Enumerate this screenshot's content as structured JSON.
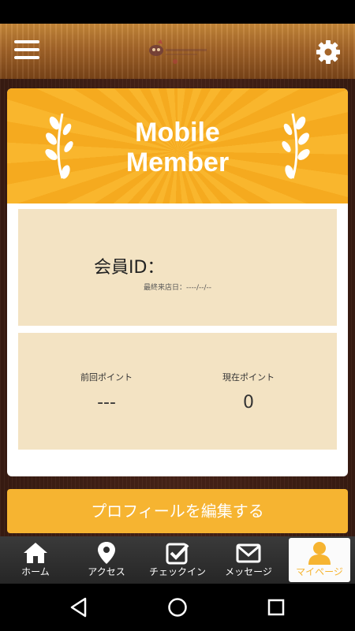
{
  "header": {
    "menu_icon": "hamburger-menu-icon",
    "logo": "shop-logo",
    "settings_icon": "gear-icon"
  },
  "card": {
    "title_line1": "Mobile",
    "title_line2": "Member",
    "member_id_label": "会員ID：",
    "last_visit": "最終来店日：----/--/--",
    "prev_points_label": "前回ポイント",
    "prev_points_value": "---",
    "current_points_label": "現在ポイント",
    "current_points_value": "0"
  },
  "profile_button_label": "プロフィールを編集する",
  "tabs": [
    {
      "label": "ホーム",
      "icon": "home-icon"
    },
    {
      "label": "アクセス",
      "icon": "map-pin-icon"
    },
    {
      "label": "チェックイン",
      "icon": "checkin-icon"
    },
    {
      "label": "メッセージ",
      "icon": "mail-icon"
    },
    {
      "label": "マイページ",
      "icon": "user-icon"
    }
  ],
  "active_tab": "マイページ",
  "colors": {
    "accent": "#f6b431",
    "panel": "#f3e3c3",
    "wood_dark": "#3a1c12",
    "wood_light": "#c98a3a"
  }
}
